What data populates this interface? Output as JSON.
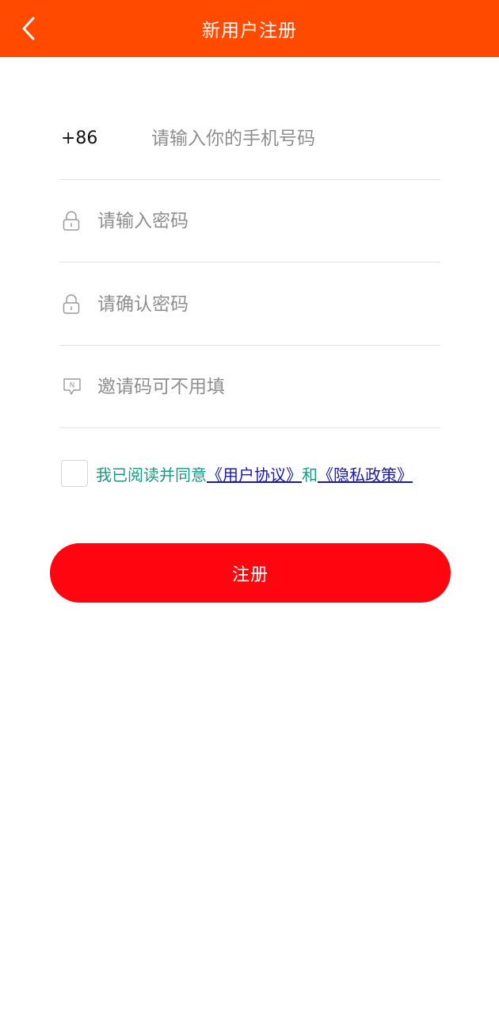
{
  "header": {
    "title": "新用户注册",
    "back_icon": "chevron-left-icon",
    "color": "#ff4a00"
  },
  "form": {
    "phone": {
      "prefix": "+86",
      "placeholder": "请输入你的手机号码",
      "value": ""
    },
    "password": {
      "icon": "lock-icon",
      "placeholder": "请输入密码",
      "value": ""
    },
    "confirm_password": {
      "icon": "lock-icon",
      "placeholder": "请确认密码",
      "value": ""
    },
    "invite_code": {
      "icon": "chat-n-icon",
      "placeholder": "邀请码可不用填",
      "value": ""
    }
  },
  "agreement": {
    "checked": false,
    "prefix_text": "我已阅读并同意",
    "user_agreement": "《用户协议》",
    "conjunction": "和",
    "privacy_policy": "《隐私政策》",
    "text_color": "#1a9a80",
    "link_color": "#1a1aa6"
  },
  "submit": {
    "label": "注册",
    "color": "#ff0510"
  }
}
